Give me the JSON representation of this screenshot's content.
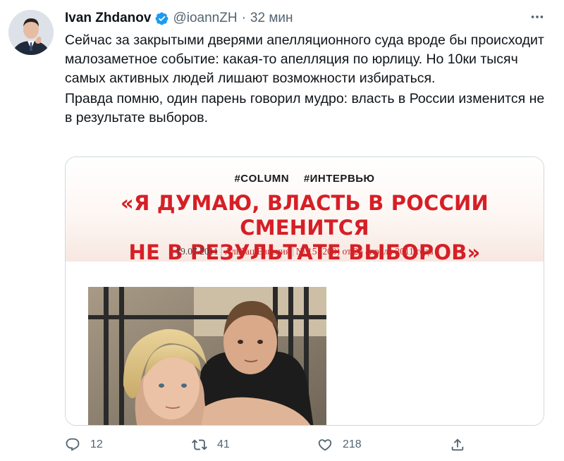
{
  "author": {
    "name": "Ivan Zhdanov",
    "handle": "@ioannZH",
    "separator": "·",
    "time": "32 мин"
  },
  "tweet": {
    "paragraphs": [
      "Сейчас за закрытыми дверями апелляционного суда вроде бы происходит малозаметное событие: какая-то апелляция по юрлицу. Но 10ки тысяч самых активных людей лишают возможности избираться.",
      "Правда помню, один парень говорил мудро: власть в России изменится не в результате выборов."
    ]
  },
  "card": {
    "tags": [
      "#COLUMN",
      "#ИНТЕРВЬЮ"
    ],
    "headline_line1": "«Я ДУМАЮ, ВЛАСТЬ В РОССИИ СМЕНИТСЯ",
    "headline_line2": "НЕ В РЕЗУЛЬТАТЕ ВЫБОРОВ»",
    "date": "19.07.2011",
    "author": "Альбац Евгения",
    "issue": "№ 15 (200) от 25 апреля 2011 года"
  },
  "actions": {
    "replies": "12",
    "retweets": "41",
    "likes": "218"
  },
  "colors": {
    "accent": "#1d9bf0",
    "headline_red": "#d61f26",
    "muted": "#536471"
  },
  "icons": [
    "verified-badge-icon",
    "more-dots-icon",
    "reply-icon",
    "retweet-icon",
    "like-icon",
    "share-icon"
  ]
}
